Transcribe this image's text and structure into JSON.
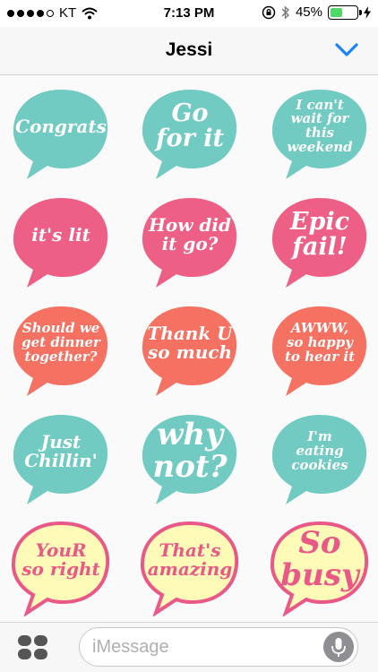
{
  "status_bar": {
    "carrier": "KT",
    "time": "7:13 PM",
    "battery_percent": "45%",
    "battery_level": 0.45,
    "icons": [
      "signal-dots-icon",
      "wifi-icon",
      "rotation-lock-icon",
      "bluetooth-icon",
      "battery-icon",
      "charging-bolt-icon"
    ]
  },
  "header": {
    "title": "Jessi",
    "collapse_icon": "chevron-down-icon",
    "accent_color": "#1a82fb"
  },
  "colors": {
    "teal": "#72cbc2",
    "pink": "#ee5f86",
    "coral": "#f57162",
    "yellow_bubble": "#fdfbb7",
    "yellow_border": "#e95886"
  },
  "stickers": [
    {
      "text": "Congrats",
      "color": "teal"
    },
    {
      "text": "Go\nfor it",
      "color": "teal"
    },
    {
      "text": "I can't\nwait for this\nweekend",
      "color": "teal"
    },
    {
      "text": "it's lit",
      "color": "pink"
    },
    {
      "text": "How did\nit go?",
      "color": "pink"
    },
    {
      "text": "Epic\nfail!",
      "color": "pink"
    },
    {
      "text": "Should we\nget dinner\ntogether?",
      "color": "coral"
    },
    {
      "text": "Thank U\nso much",
      "color": "coral"
    },
    {
      "text": "AWWW,\nso happy\nto hear it",
      "color": "coral"
    },
    {
      "text": "Just\nChillin'",
      "color": "teal"
    },
    {
      "text": "why\nnot?",
      "color": "teal"
    },
    {
      "text": "I'm\neating\ncookies",
      "color": "teal"
    },
    {
      "text": "YouR\nso right",
      "color": "yellow"
    },
    {
      "text": "That's\namazing",
      "color": "yellow"
    },
    {
      "text": "So\nbusy",
      "color": "yellow"
    }
  ],
  "compose": {
    "placeholder": "iMessage",
    "apps_icon": "app-drawer-icon",
    "mic_icon": "microphone-icon"
  }
}
